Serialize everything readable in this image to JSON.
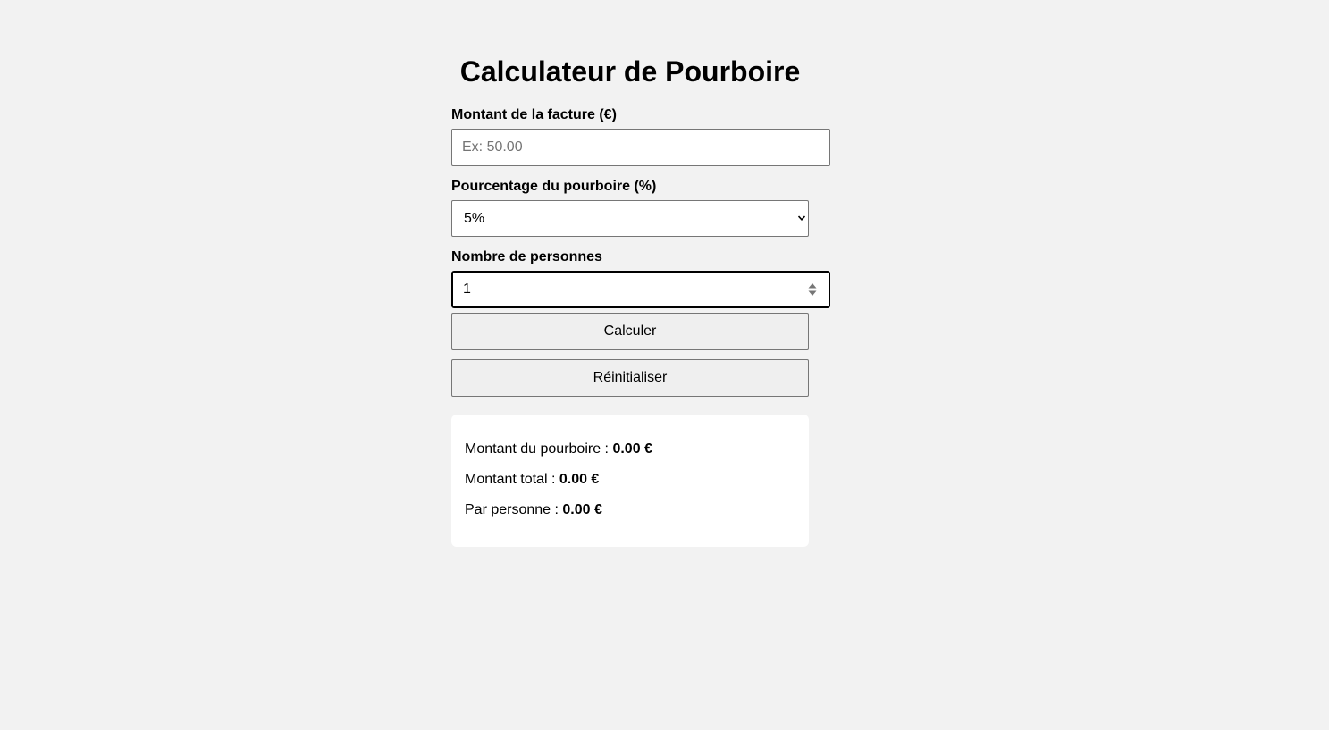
{
  "page": {
    "title": "Calculateur de Pourboire"
  },
  "form": {
    "bill": {
      "label": "Montant de la facture (€)",
      "placeholder": "Ex: 50.00",
      "value": ""
    },
    "tip": {
      "label": "Pourcentage du pourboire (%)",
      "selected": "5%"
    },
    "people": {
      "label": "Nombre de personnes",
      "value": "1"
    },
    "calculate_label": "Calculer",
    "reset_label": "Réinitialiser"
  },
  "results": {
    "tip_label": "Montant du pourboire :",
    "tip_value": "0.00 €",
    "total_label": "Montant total :",
    "total_value": "0.00 €",
    "per_person_label": "Par personne :",
    "per_person_value": "0.00 €"
  },
  "colors": {
    "background": "#f2f2f2",
    "card": "#ffffff",
    "button": "#efefef",
    "border": "#767676"
  }
}
